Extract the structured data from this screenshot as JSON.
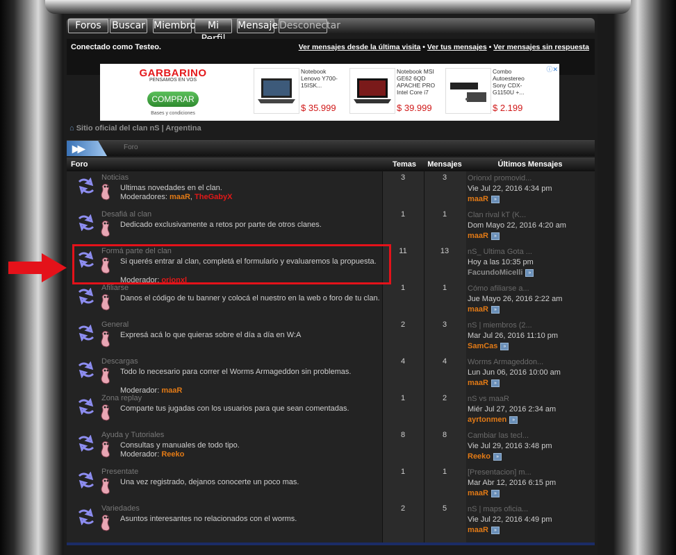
{
  "nav": {
    "items": [
      "Foros",
      "Buscar",
      "Miembros",
      "Mi Perfil",
      "Mensajes",
      "Desconectar"
    ]
  },
  "header": {
    "logged_in": "Conectado como Testeo.",
    "link_since_last": "Ver mensajes desde la última visita",
    "link_yours": "Ver tus mensajes",
    "link_unanswered": "Ver mensajes sin respuesta",
    "separator": "•"
  },
  "ad": {
    "brand": "GARBARINO",
    "tagline": "PENSAMOS EN VOS",
    "button": "COMPRAR",
    "conditions": "Bases y condiciones",
    "products": [
      {
        "title": "Notebook Lenovo Y700-15ISK...",
        "price": "$ 35.999"
      },
      {
        "title": "Notebook MSI GE62 6QD APACHE PRO Intel Core i7",
        "price": "$ 39.999"
      },
      {
        "title": "Combo Autoestereo Sony CDX-G1150U +...",
        "price": "$ 2.199"
      }
    ]
  },
  "breadcrumb": "Sitio oficial del clan nS | Argentina",
  "tabbar": {
    "label": "Foro"
  },
  "table": {
    "headers": {
      "forum": "Foro",
      "topics": "Temas",
      "posts": "Mensajes",
      "last": "Últimos Mensajes"
    },
    "rows": [
      {
        "name": "Noticias",
        "desc": "Ultimas novedades en el clan.",
        "mod_label": "Moderadores:",
        "mods": [
          {
            "name": "maaR",
            "color": "#e27a16"
          },
          {
            "name": "TheGabyX",
            "color": "#e21818"
          }
        ],
        "topics": "3",
        "posts": "3",
        "last_title": "Orionxl promovid...",
        "last_date": "Vie Jul 22, 2016 4:34 pm",
        "last_user": "maaR",
        "last_user_color": "#e27a16"
      },
      {
        "name": "Desafiá al clan",
        "desc": "Dedicado exclusivamente a retos por parte de otros clanes.",
        "mod_label": "",
        "mods": [],
        "topics": "1",
        "posts": "1",
        "last_title": "Clan rival kT (K...",
        "last_date": "Dom Mayo 22, 2016 4:20 am",
        "last_user": "maaR",
        "last_user_color": "#e27a16"
      },
      {
        "name": "Formá parte del clan",
        "desc": "Si querés entrar al clan, completá el formulario y evaluaremos la propuesta.",
        "mod_label": "Moderador:",
        "mods": [
          {
            "name": "orionxl",
            "color": "#e21818"
          }
        ],
        "topics": "11",
        "posts": "13",
        "last_title": "nS_ Ultima Gota ...",
        "last_date": "Hoy a las 10:35 pm",
        "last_user": "FacundoMicelli",
        "last_user_color": "#8a8a8a"
      },
      {
        "name": "Afiliarse",
        "desc": "Danos el código de tu banner y colocá el nuestro en la web o foro de tu clan.",
        "mod_label": "",
        "mods": [],
        "topics": "1",
        "posts": "1",
        "last_title": "Cómo afiliarse a...",
        "last_date": "Jue Mayo 26, 2016 2:22 am",
        "last_user": "maaR",
        "last_user_color": "#e27a16"
      },
      {
        "name": "General",
        "desc": "Expresá acá lo que quieras sobre el día a día en W:A",
        "mod_label": "",
        "mods": [],
        "topics": "2",
        "posts": "3",
        "last_title": "nS | miembros (2...",
        "last_date": "Mar Jul 26, 2016 11:10 pm",
        "last_user": "SamCas",
        "last_user_color": "#e27a16"
      },
      {
        "name": "Descargas",
        "desc": "Todo lo necesario para correr el Worms Armageddon sin problemas.",
        "mod_label": "Moderador:",
        "mods": [
          {
            "name": "maaR",
            "color": "#e27a16"
          }
        ],
        "topics": "4",
        "posts": "4",
        "last_title": "Worms Armageddon...",
        "last_date": "Lun Jun 06, 2016 10:00 am",
        "last_user": "maaR",
        "last_user_color": "#e27a16"
      },
      {
        "name": "Zona replay",
        "desc": "Comparte tus jugadas con los usuarios para que sean comentadas.",
        "mod_label": "",
        "mods": [],
        "topics": "1",
        "posts": "2",
        "last_title": "nS vs maaR",
        "last_date": "Miér Jul 27, 2016 2:34 am",
        "last_user": "ayrtonmen",
        "last_user_color": "#e27a16"
      },
      {
        "name": "Ayuda y Tutoriales",
        "desc": "Consultas y manuales de todo tipo.",
        "mod_label": "Moderador:",
        "mods": [
          {
            "name": "Reeko",
            "color": "#e27a16"
          }
        ],
        "topics": "8",
        "posts": "8",
        "last_title": "Cambiar las tecl...",
        "last_date": "Vie Jul 29, 2016 3:48 pm",
        "last_user": "Reeko",
        "last_user_color": "#e27a16"
      },
      {
        "name": "Presentate",
        "desc": "Una vez registrado, dejanos conocerte un poco mas.",
        "mod_label": "",
        "mods": [],
        "topics": "1",
        "posts": "1",
        "last_title": "[Presentacion] m...",
        "last_date": "Mar Abr 12, 2016 6:15 pm",
        "last_user": "maaR",
        "last_user_color": "#e27a16"
      },
      {
        "name": "Variedades",
        "desc": "Asuntos interesantes no relacionados con el worms.",
        "mod_label": "",
        "mods": [],
        "topics": "2",
        "posts": "5",
        "last_title": "nS | maps oficia...",
        "last_date": "Vie Jul 22, 2016 4:49 pm",
        "last_user": "maaR",
        "last_user_color": "#e27a16"
      }
    ]
  },
  "colors": {
    "highlight": "#e4121a",
    "accent_orange": "#e27a16",
    "accent_red": "#e21818",
    "link_blue": "#6a8fb8"
  }
}
